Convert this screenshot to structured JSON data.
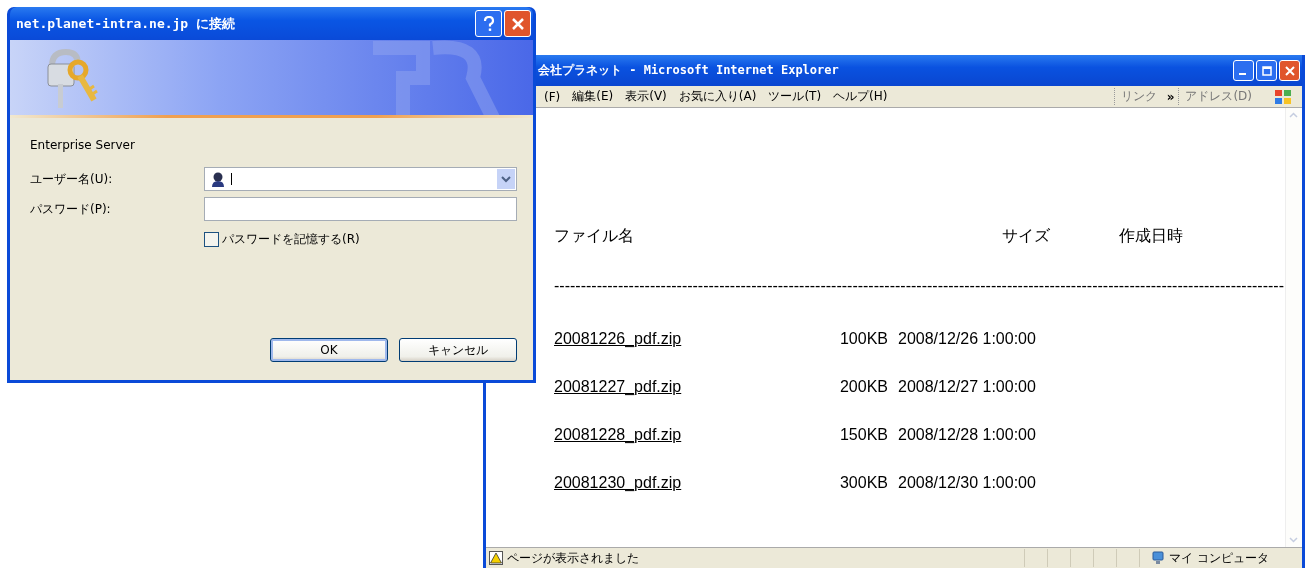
{
  "dialog": {
    "title": "net.planet-intra.ne.jp に接続",
    "server": "Enterprise Server",
    "username": {
      "label": "ユーザー名(U):"
    },
    "password": {
      "label": "パスワード(P):"
    },
    "remember": {
      "label": "パスワードを記憶する(R)",
      "checked": false
    },
    "buttons": [
      "OK",
      "キャンセル"
    ]
  },
  "browser": {
    "title": "会社プラネット - Microsoft Internet Explorer",
    "menu": [
      "(F)",
      "編集(E)",
      "表示(V)",
      "お気に入り(A)",
      "ツール(T)",
      "ヘルプ(H)"
    ],
    "links": "リンク",
    "links_more": "»",
    "address": "アドレス(D)",
    "table": {
      "columns": [
        "ファイル名",
        "サイズ",
        "作成日時"
      ],
      "rule": "-----------------------------------------------------------------------------------------------------------------------------------------",
      "rows": [
        {
          "name": "20081226_pdf.zip",
          "size": "100KB",
          "date": "2008/12/26 1:00:00"
        },
        {
          "name": "20081227_pdf.zip",
          "size": "200KB",
          "date": "2008/12/27 1:00:00"
        },
        {
          "name": "20081228_pdf.zip",
          "size": "150KB",
          "date": "2008/12/28 1:00:00"
        },
        {
          "name": "20081230_pdf.zip",
          "size": "300KB",
          "date": "2008/12/30 1:00:00"
        }
      ]
    },
    "status_bar": {
      "message": "ページが表示されました",
      "zone": "マイ コンピュータ"
    }
  }
}
